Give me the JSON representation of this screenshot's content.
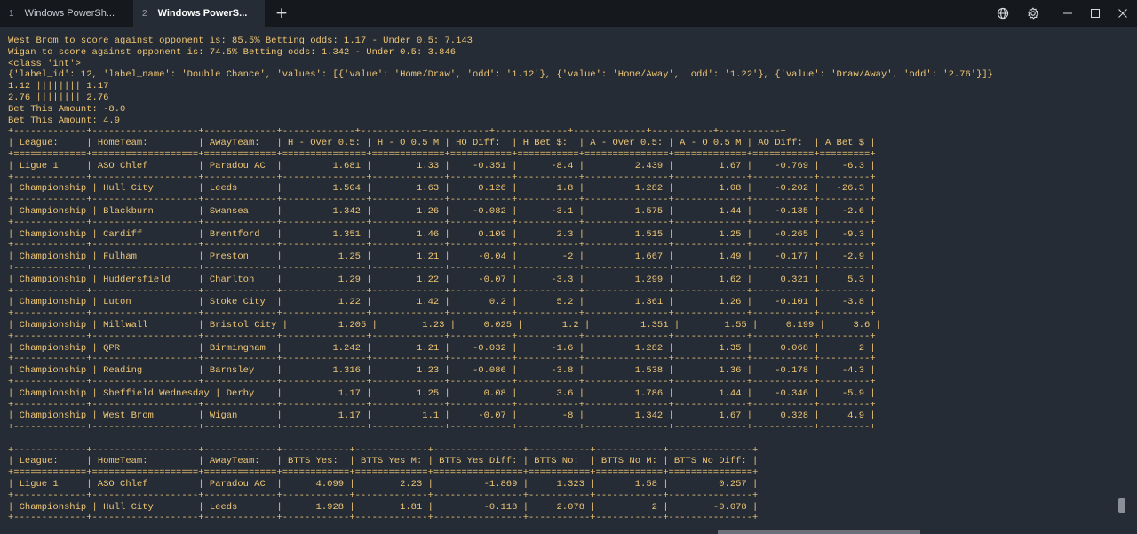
{
  "tabs": [
    {
      "index": "1",
      "title": "Windows PowerSh..."
    },
    {
      "index": "2",
      "title": "Windows PowerS..."
    }
  ],
  "toolbar": {
    "new_tab_label": "+",
    "icons": [
      "globe-icon",
      "gear-icon",
      "minimize-icon",
      "maximize-icon",
      "close-icon"
    ]
  },
  "colors": {
    "terminal_background": "#262c36",
    "terminal_text": "#efc674",
    "tabbar_background": "#15181d"
  },
  "terminal": {
    "lines": [
      "West Brom to score against opponent is: 85.5% Betting odds: 1.17 - Under 0.5: 7.143",
      "Wigan to score against opponent is: 74.5% Betting odds: 1.342 - Under 0.5: 3.846",
      "<class 'int'>",
      "{'label_id': 12, 'label_name': 'Double Chance', 'values': [{'value': 'Home/Draw', 'odd': '1.12'}, {'value': 'Home/Away', 'odd': '1.22'}, {'value': 'Draw/Away', 'odd': '2.76'}]}",
      "1.12 |||||||| 1.17",
      "2.76 |||||||| 2.76",
      "Bet This Amount: -8.0",
      "Bet This Amount: 4.9",
      "+-------------+-------------------+-------------+-------------+-----------+-----------+-------------+-------------+-----------+-----------+",
      "| League:     | HomeTeam:         | AwayTeam:   | H - Over 0.5: | H - O 0.5 M | HO Diff:  | H Bet $:  | A - Over 0.5: | A - O 0.5 M | AO Diff:  | A Bet $ |",
      "+=============+===================+=============+===============+=============+===========+===========+===============+=============+===========+=========+",
      "| Ligue 1     | ASO Chlef         | Paradou AC  |         1.681 |        1.33 |    -0.351 |      -8.4 |         2.439 |        1.67 |    -0.769 |    -6.3 |",
      "+-------------+-------------------+-------------+---------------+-------------+-----------+-----------+---------------+-------------+-----------+---------+",
      "| Championship | Hull City        | Leeds       |         1.504 |        1.63 |     0.126 |       1.8 |         1.282 |        1.08 |    -0.202 |   -26.3 |",
      "+-------------+-------------------+-------------+---------------+-------------+-----------+-----------+---------------+-------------+-----------+---------+",
      "| Championship | Blackburn        | Swansea     |         1.342 |        1.26 |    -0.082 |      -3.1 |         1.575 |        1.44 |    -0.135 |    -2.6 |",
      "+-------------+-------------------+-------------+---------------+-------------+-----------+-----------+---------------+-------------+-----------+---------+",
      "| Championship | Cardiff          | Brentford   |         1.351 |        1.46 |     0.109 |       2.3 |         1.515 |        1.25 |    -0.265 |    -9.3 |",
      "+-------------+-------------------+-------------+---------------+-------------+-----------+-----------+---------------+-------------+-----------+---------+",
      "| Championship | Fulham           | Preston     |          1.25 |        1.21 |     -0.04 |        -2 |         1.667 |        1.49 |    -0.177 |    -2.9 |",
      "+-------------+-------------------+-------------+---------------+-------------+-----------+-----------+---------------+-------------+-----------+---------+",
      "| Championship | Huddersfield     | Charlton    |          1.29 |        1.22 |     -0.07 |      -3.3 |         1.299 |        1.62 |     0.321 |     5.3 |",
      "+-------------+-------------------+-------------+---------------+-------------+-----------+-----------+---------------+-------------+-----------+---------+",
      "| Championship | Luton            | Stoke City  |          1.22 |        1.42 |       0.2 |       5.2 |         1.361 |        1.26 |    -0.101 |    -3.8 |",
      "+-------------+-------------------+-------------+---------------+-------------+-----------+-----------+---------------+-------------+-----------+---------+",
      "| Championship | Millwall         | Bristol City |         1.205 |        1.23 |     0.025 |       1.2 |         1.351 |        1.55 |     0.199 |     3.6 |",
      "+-------------+-------------------+-------------+---------------+-------------+-----------+-----------+---------------+-------------+-----------+---------+",
      "| Championship | QPR              | Birmingham  |         1.242 |        1.21 |    -0.032 |      -1.6 |         1.282 |        1.35 |     0.068 |       2 |",
      "+-------------+-------------------+-------------+---------------+-------------+-----------+-----------+---------------+-------------+-----------+---------+",
      "| Championship | Reading          | Barnsley    |         1.316 |        1.23 |    -0.086 |      -3.8 |         1.538 |        1.36 |    -0.178 |    -4.3 |",
      "+-------------+-------------------+-------------+---------------+-------------+-----------+-----------+---------------+-------------+-----------+---------+",
      "| Championship | Sheffield Wednesday | Derby    |          1.17 |        1.25 |      0.08 |       3.6 |         1.786 |        1.44 |    -0.346 |    -5.9 |",
      "+-------------+-------------------+-------------+---------------+-------------+-----------+-----------+---------------+-------------+-----------+---------+",
      "| Championship | West Brom        | Wigan       |          1.17 |         1.1 |     -0.07 |        -8 |         1.342 |        1.67 |     0.328 |     4.9 |",
      "+-------------+-------------------+-------------+---------------+-------------+-----------+-----------+---------------+-------------+-----------+---------+",
      "",
      "+-------------+-------------------+-------------+------------+-------------+----------------+-----------+------------+---------------+",
      "| League:     | HomeTeam:         | AwayTeam:   | BTTS Yes:  | BTTS Yes M: | BTTS Yes Diff: | BTTS No:  | BTTS No M: | BTTS No Diff: |",
      "+=============+===================+=============+============+=============+================+===========+============+===============+",
      "| Ligue 1     | ASO Chlef         | Paradou AC  |      4.099 |        2.23 |         -1.869 |     1.323 |       1.58 |         0.257 |",
      "+-------------+-------------------+-------------+------------+-------------+----------------+-----------+------------+---------------+",
      "| Championship | Hull City        | Leeds       |      1.928 |        1.81 |         -0.118 |     2.078 |          2 |        -0.078 |",
      "+-------------+-------------------+-------------+------------+-------------+----------------+-----------+------------+---------------+"
    ]
  }
}
